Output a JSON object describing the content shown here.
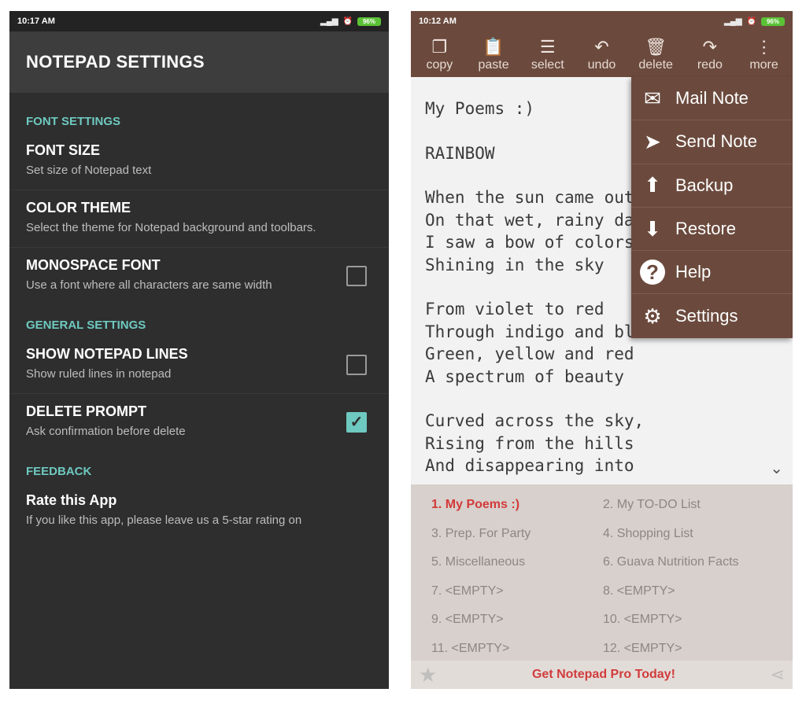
{
  "left": {
    "status": {
      "time": "10:17 AM",
      "battery": "96%"
    },
    "title": "NOTEPAD SETTINGS",
    "sections": [
      {
        "header": "FONT SETTINGS",
        "items": [
          {
            "title": "FONT SIZE",
            "summary": "Set size of Notepad text",
            "checkbox": null
          },
          {
            "title": "COLOR THEME",
            "summary": "Select the theme for Notepad background and toolbars.",
            "checkbox": null
          },
          {
            "title": "MONOSPACE FONT",
            "summary": "Use a font where all characters are same width",
            "checkbox": false
          }
        ]
      },
      {
        "header": "GENERAL SETTINGS",
        "items": [
          {
            "title": "SHOW NOTEPAD LINES",
            "summary": "Show ruled lines in notepad",
            "checkbox": false
          },
          {
            "title": "DELETE PROMPT",
            "summary": "Ask confirmation before delete",
            "checkbox": true
          }
        ]
      },
      {
        "header": "FEEDBACK",
        "items": [
          {
            "title": "Rate this App",
            "summary": "If you like this app, please leave us a 5-star rating on",
            "checkbox": null
          }
        ]
      }
    ]
  },
  "right": {
    "status": {
      "time": "10:12 AM",
      "battery": "96%"
    },
    "toolbar": [
      {
        "label": "copy",
        "icon": "copy-icon"
      },
      {
        "label": "paste",
        "icon": "paste-icon"
      },
      {
        "label": "select",
        "icon": "select-icon"
      },
      {
        "label": "undo",
        "icon": "undo-icon"
      },
      {
        "label": "delete",
        "icon": "delete-icon"
      },
      {
        "label": "redo",
        "icon": "redo-icon"
      },
      {
        "label": "more",
        "icon": "more-icon"
      }
    ],
    "note_lines": [
      "My Poems :)",
      "",
      "RAINBOW",
      "",
      "When the sun came out",
      "On that wet, rainy day",
      "I saw a bow of colors",
      "Shining in the sky",
      "",
      "From violet to red",
      "Through indigo and blue",
      "Green, yellow and red",
      "A spectrum of beauty",
      "",
      "Curved across the sky,",
      "Rising from the hills",
      "And disappearing into"
    ],
    "menu": [
      {
        "label": "Mail Note",
        "icon": "mail-icon"
      },
      {
        "label": "Send Note",
        "icon": "send-icon"
      },
      {
        "label": "Backup",
        "icon": "upload-icon"
      },
      {
        "label": "Restore",
        "icon": "download-icon"
      },
      {
        "label": "Help",
        "icon": "help-icon"
      },
      {
        "label": "Settings",
        "icon": "gear-icon"
      }
    ],
    "notes": [
      "1. My Poems :)",
      "2. My TO-DO List",
      "3. Prep. For Party",
      "4. Shopping List",
      "5. Miscellaneous",
      "6. Guava Nutrition Facts",
      "7. <EMPTY>",
      "8. <EMPTY>",
      "9. <EMPTY>",
      "10. <EMPTY>",
      "11. <EMPTY>",
      "12. <EMPTY>"
    ],
    "active_note_index": 0,
    "promo": "Get Notepad Pro Today!"
  },
  "colors": {
    "accent_teal": "#6ec9c0",
    "toolbar_brown": "#6b4a3d",
    "promo_red": "#d13c3c",
    "settings_bg": "#2e2e2e"
  }
}
